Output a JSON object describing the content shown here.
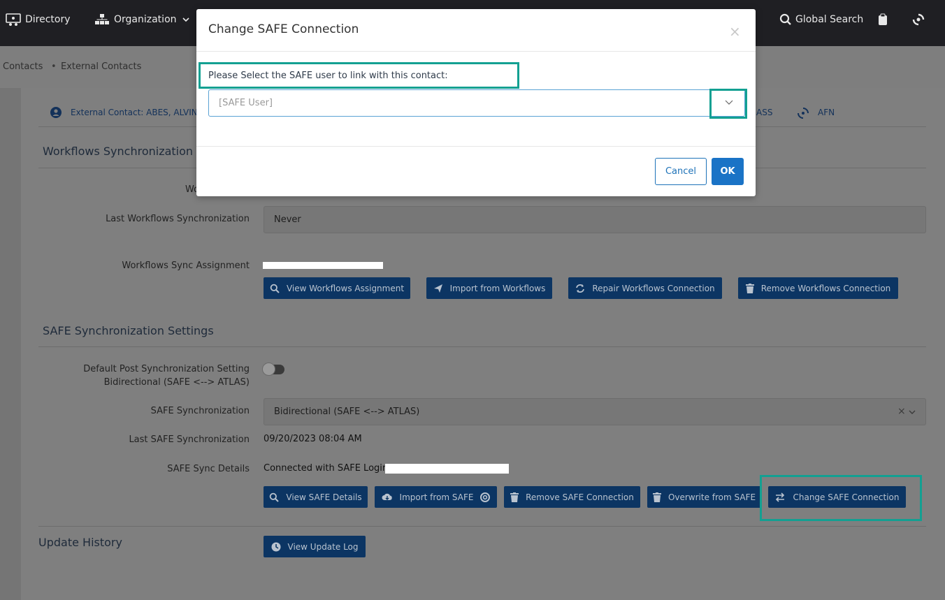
{
  "nav": {
    "directory": "Directory",
    "organization": "Organization",
    "global_search": "Global Search"
  },
  "breadcrumb": [
    "Contacts",
    "External Contacts"
  ],
  "contact_header": {
    "name": "External Contact: ABES, ALVIN",
    "tab_pass": "ASS",
    "tab_afn": "AFN"
  },
  "workflows": {
    "title": "Workflows Synchronization",
    "partial_label": "Wo",
    "last_sync_label": "Last Workflows Synchronization",
    "last_sync_value": "Never",
    "assignment_label": "Workflows Sync Assignment",
    "buttons": [
      "View Workflows Assignment",
      "Import from Workflows",
      "Repair Workflows Connection",
      "Remove Workflows Connection"
    ]
  },
  "safe": {
    "title": "SAFE Synchronization Settings",
    "post_sync_label_1": "Default Post Synchronization Setting",
    "post_sync_label_2": "Bidirectional (SAFE <--> ATLAS)",
    "sync_label": "SAFE Synchronization",
    "sync_value": "Bidirectional (SAFE <--> ATLAS)",
    "last_sync_label": "Last SAFE Synchronization",
    "last_sync_value": "09/20/2023 08:04 AM",
    "details_label": "SAFE Sync Details",
    "details_value": "Connected with SAFE Login",
    "buttons": [
      "View SAFE Details",
      "Import from SAFE",
      "Remove SAFE Connection",
      "Overwrite from SAFE",
      "Change SAFE Connection"
    ]
  },
  "update_history": {
    "title": "Update History",
    "button": "View Update Log"
  },
  "modal": {
    "title": "Change SAFE Connection",
    "close": "×",
    "prompt": "Please Select the SAFE user to link with this contact:",
    "placeholder": "[SAFE User]",
    "cancel": "Cancel",
    "ok": "OK"
  },
  "colors": {
    "highlight": "#13a092",
    "primary": "#1a73c6",
    "button_dark": "#0c3563"
  }
}
